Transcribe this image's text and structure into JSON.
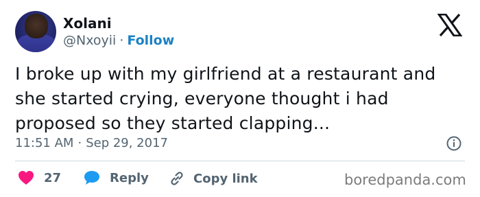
{
  "author": {
    "name": "Xolani",
    "handle": "@Nxoyii",
    "separator": "·",
    "follow_label": "Follow"
  },
  "tweet": {
    "text": "I broke up with my girlfriend at a restaurant and she started crying, everyone thought i had proposed so they started clapping..."
  },
  "meta": {
    "time": "11:51 AM",
    "separator": "·",
    "date": "Sep 29, 2017"
  },
  "actions": {
    "like_count": "27",
    "reply_label": "Reply",
    "copy_label": "Copy link"
  },
  "watermark": "boredpanda.com",
  "colors": {
    "like": "#f91880",
    "reply": "#1d9bf0",
    "follow": "#1d82c4",
    "muted": "#536471"
  },
  "icons": [
    "x-logo-icon",
    "info-icon",
    "heart-icon",
    "reply-bubble-icon",
    "link-icon"
  ]
}
